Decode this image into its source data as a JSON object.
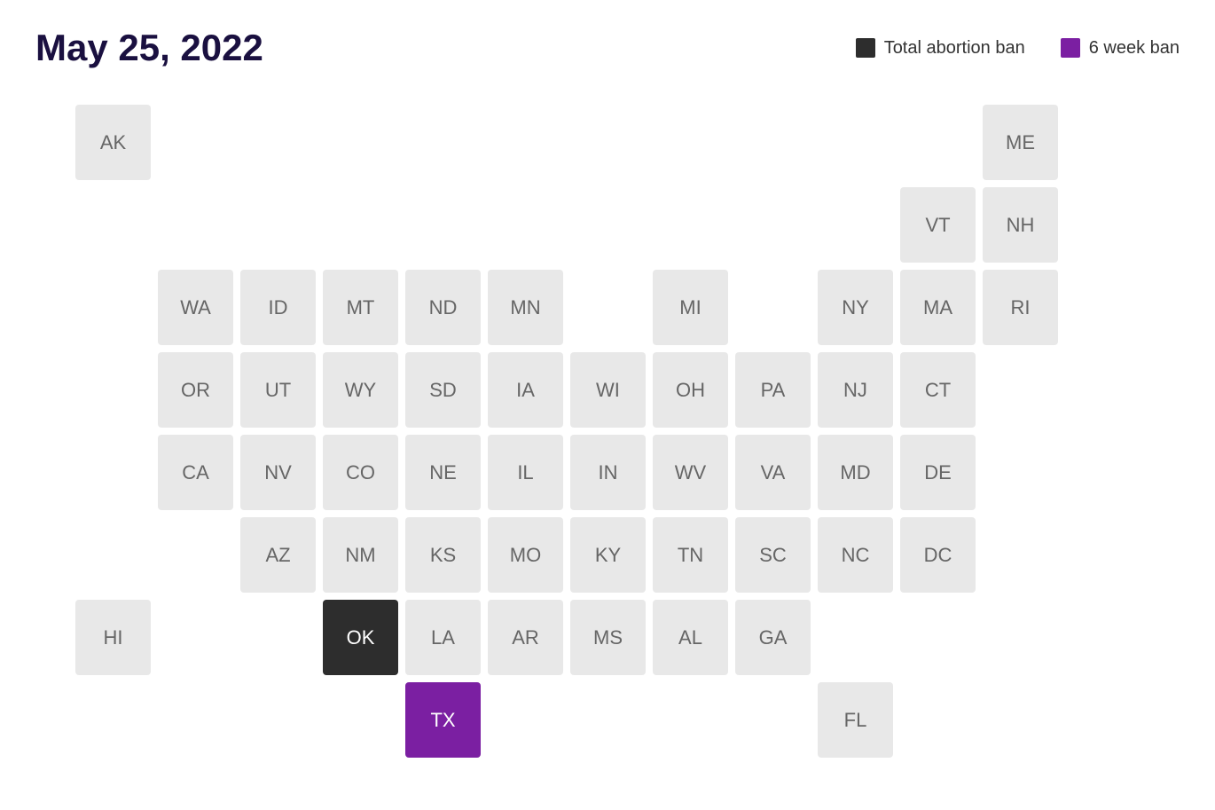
{
  "header": {
    "title": "May 25, 2022",
    "legend": {
      "total_ban_label": "Total abortion ban",
      "six_week_label": "6 week ban"
    }
  },
  "states": [
    {
      "abbr": "AK",
      "col": 1,
      "row": 1,
      "status": "none"
    },
    {
      "abbr": "ME",
      "col": 12,
      "row": 1,
      "status": "none"
    },
    {
      "abbr": "VT",
      "col": 11,
      "row": 2,
      "status": "none"
    },
    {
      "abbr": "NH",
      "col": 12,
      "row": 2,
      "status": "none"
    },
    {
      "abbr": "WA",
      "col": 2,
      "row": 3,
      "status": "none"
    },
    {
      "abbr": "ID",
      "col": 3,
      "row": 3,
      "status": "none"
    },
    {
      "abbr": "MT",
      "col": 4,
      "row": 3,
      "status": "none"
    },
    {
      "abbr": "ND",
      "col": 5,
      "row": 3,
      "status": "none"
    },
    {
      "abbr": "MN",
      "col": 6,
      "row": 3,
      "status": "none"
    },
    {
      "abbr": "MI",
      "col": 8,
      "row": 3,
      "status": "none"
    },
    {
      "abbr": "NY",
      "col": 10,
      "row": 3,
      "status": "none"
    },
    {
      "abbr": "MA",
      "col": 11,
      "row": 3,
      "status": "none"
    },
    {
      "abbr": "RI",
      "col": 12,
      "row": 3,
      "status": "none"
    },
    {
      "abbr": "OR",
      "col": 2,
      "row": 4,
      "status": "none"
    },
    {
      "abbr": "UT",
      "col": 3,
      "row": 4,
      "status": "none"
    },
    {
      "abbr": "WY",
      "col": 4,
      "row": 4,
      "status": "none"
    },
    {
      "abbr": "SD",
      "col": 5,
      "row": 4,
      "status": "none"
    },
    {
      "abbr": "IA",
      "col": 6,
      "row": 4,
      "status": "none"
    },
    {
      "abbr": "WI",
      "col": 7,
      "row": 4,
      "status": "none"
    },
    {
      "abbr": "OH",
      "col": 8,
      "row": 4,
      "status": "none"
    },
    {
      "abbr": "PA",
      "col": 9,
      "row": 4,
      "status": "none"
    },
    {
      "abbr": "NJ",
      "col": 10,
      "row": 4,
      "status": "none"
    },
    {
      "abbr": "CT",
      "col": 11,
      "row": 4,
      "status": "none"
    },
    {
      "abbr": "CA",
      "col": 2,
      "row": 5,
      "status": "none"
    },
    {
      "abbr": "NV",
      "col": 3,
      "row": 5,
      "status": "none"
    },
    {
      "abbr": "CO",
      "col": 4,
      "row": 5,
      "status": "none"
    },
    {
      "abbr": "NE",
      "col": 5,
      "row": 5,
      "status": "none"
    },
    {
      "abbr": "IL",
      "col": 6,
      "row": 5,
      "status": "none"
    },
    {
      "abbr": "IN",
      "col": 7,
      "row": 5,
      "status": "none"
    },
    {
      "abbr": "WV",
      "col": 8,
      "row": 5,
      "status": "none"
    },
    {
      "abbr": "VA",
      "col": 9,
      "row": 5,
      "status": "none"
    },
    {
      "abbr": "MD",
      "col": 10,
      "row": 5,
      "status": "none"
    },
    {
      "abbr": "DE",
      "col": 11,
      "row": 5,
      "status": "none"
    },
    {
      "abbr": "AZ",
      "col": 3,
      "row": 6,
      "status": "none"
    },
    {
      "abbr": "NM",
      "col": 4,
      "row": 6,
      "status": "none"
    },
    {
      "abbr": "KS",
      "col": 5,
      "row": 6,
      "status": "none"
    },
    {
      "abbr": "MO",
      "col": 6,
      "row": 6,
      "status": "none"
    },
    {
      "abbr": "KY",
      "col": 7,
      "row": 6,
      "status": "none"
    },
    {
      "abbr": "TN",
      "col": 8,
      "row": 6,
      "status": "none"
    },
    {
      "abbr": "SC",
      "col": 9,
      "row": 6,
      "status": "none"
    },
    {
      "abbr": "NC",
      "col": 10,
      "row": 6,
      "status": "none"
    },
    {
      "abbr": "DC",
      "col": 11,
      "row": 6,
      "status": "none"
    },
    {
      "abbr": "HI",
      "col": 1,
      "row": 7,
      "status": "none"
    },
    {
      "abbr": "OK",
      "col": 4,
      "row": 7,
      "status": "total-ban"
    },
    {
      "abbr": "LA",
      "col": 5,
      "row": 7,
      "status": "none"
    },
    {
      "abbr": "AR",
      "col": 6,
      "row": 7,
      "status": "none"
    },
    {
      "abbr": "MS",
      "col": 7,
      "row": 7,
      "status": "none"
    },
    {
      "abbr": "AL",
      "col": 8,
      "row": 7,
      "status": "none"
    },
    {
      "abbr": "GA",
      "col": 9,
      "row": 7,
      "status": "none"
    },
    {
      "abbr": "TX",
      "col": 5,
      "row": 8,
      "status": "six-week-ban"
    },
    {
      "abbr": "FL",
      "col": 10,
      "row": 8,
      "status": "none"
    }
  ]
}
